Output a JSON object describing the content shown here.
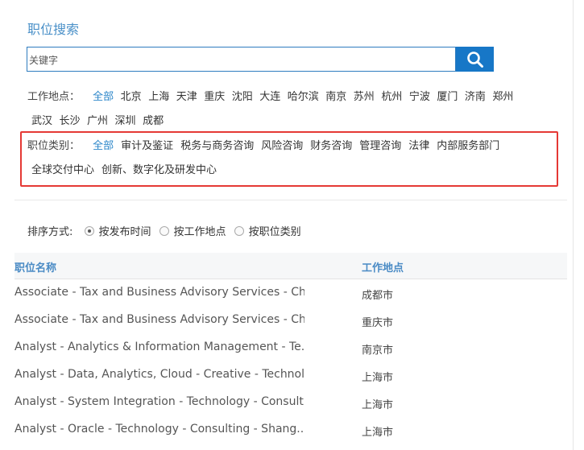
{
  "title": "职位搜索",
  "search": {
    "placeholder": "关键字"
  },
  "location_filter": {
    "label": "工作地点：",
    "options_line1": [
      "全部",
      "北京",
      "上海",
      "天津",
      "重庆",
      "沈阳",
      "大连",
      "哈尔滨",
      "南京",
      "苏州",
      "杭州",
      "宁波",
      "厦门",
      "济南",
      "郑州"
    ],
    "options_line2": [
      "武汉",
      "长沙",
      "广州",
      "深圳",
      "成都"
    ],
    "selected": "全部"
  },
  "category_filter": {
    "label": "职位类别：",
    "options_line1": [
      "全部",
      "审计及鉴证",
      "税务与商务咨询",
      "风险咨询",
      "财务咨询",
      "管理咨询",
      "法律",
      "内部服务部门"
    ],
    "options_line2": [
      "全球交付中心",
      "创新、数字化及研发中心"
    ],
    "selected": "全部"
  },
  "sort": {
    "label": "排序方式:",
    "options": [
      "按发布时间",
      "按工作地点",
      "按职位类别"
    ],
    "selected": "按发布时间"
  },
  "table": {
    "columns": [
      "职位名称",
      "工作地点"
    ],
    "rows": [
      {
        "name": "Associate - Tax and Business Advisory Services - Ch...",
        "location": "成都市"
      },
      {
        "name": "Associate - Tax and Business Advisory Services - Ch...",
        "location": "重庆市"
      },
      {
        "name": "Analyst - Analytics & Information Management - Te...",
        "location": "南京市"
      },
      {
        "name": "Analyst - Data, Analytics, Cloud - Creative - Technol...",
        "location": "上海市"
      },
      {
        "name": "Analyst - System Integration - Technology - Consult...",
        "location": "上海市"
      },
      {
        "name": "Analyst - Oracle - Technology - Consulting - Shang...",
        "location": "上海市"
      }
    ]
  }
}
